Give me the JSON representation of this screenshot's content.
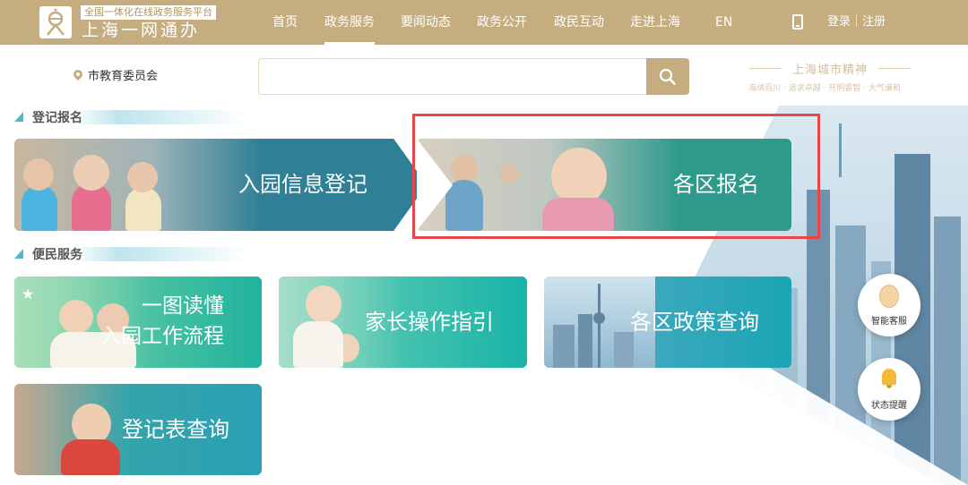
{
  "header": {
    "platform_tagline": "全国一体化在线政务服务平台",
    "brand": "上海一网通办",
    "nav": [
      {
        "label": "首页"
      },
      {
        "label": "政务服务",
        "active": true
      },
      {
        "label": "要闻动态"
      },
      {
        "label": "政务公开"
      },
      {
        "label": "政民互动"
      },
      {
        "label": "走进上海"
      },
      {
        "label": "EN"
      }
    ],
    "login_label": "登录｜注册",
    "icons": {
      "phone": "mobile-phone-icon",
      "logo": "shanghai-emblem-icon"
    }
  },
  "location": {
    "label": "市教育委员会",
    "icon": "location-pin-icon"
  },
  "search": {
    "placeholder": "",
    "value": "",
    "icon": "search-icon"
  },
  "city_spirit": {
    "title": "上海城市精神",
    "subtitle": "海纳百川 · 追求卓越 · 开明睿智 · 大气谦和"
  },
  "sections": {
    "registration": {
      "title": "登记报名",
      "cards": [
        {
          "label": "入园信息登记"
        },
        {
          "label": "各区报名",
          "highlighted": true
        }
      ]
    },
    "services": {
      "title": "便民服务",
      "cards": [
        {
          "line1": "一图读懂",
          "line2": "入园工作流程"
        },
        {
          "label": "家长操作指引"
        },
        {
          "label": "各区政策查询"
        },
        {
          "label": "登记表查询"
        }
      ]
    }
  },
  "floating": {
    "assistant_label": "智能客服",
    "status_label": "状态提醒"
  },
  "colors": {
    "header_gold": "#c5ad80",
    "accent_teal": "#4bbad0",
    "highlight_red": "#e8474a"
  }
}
